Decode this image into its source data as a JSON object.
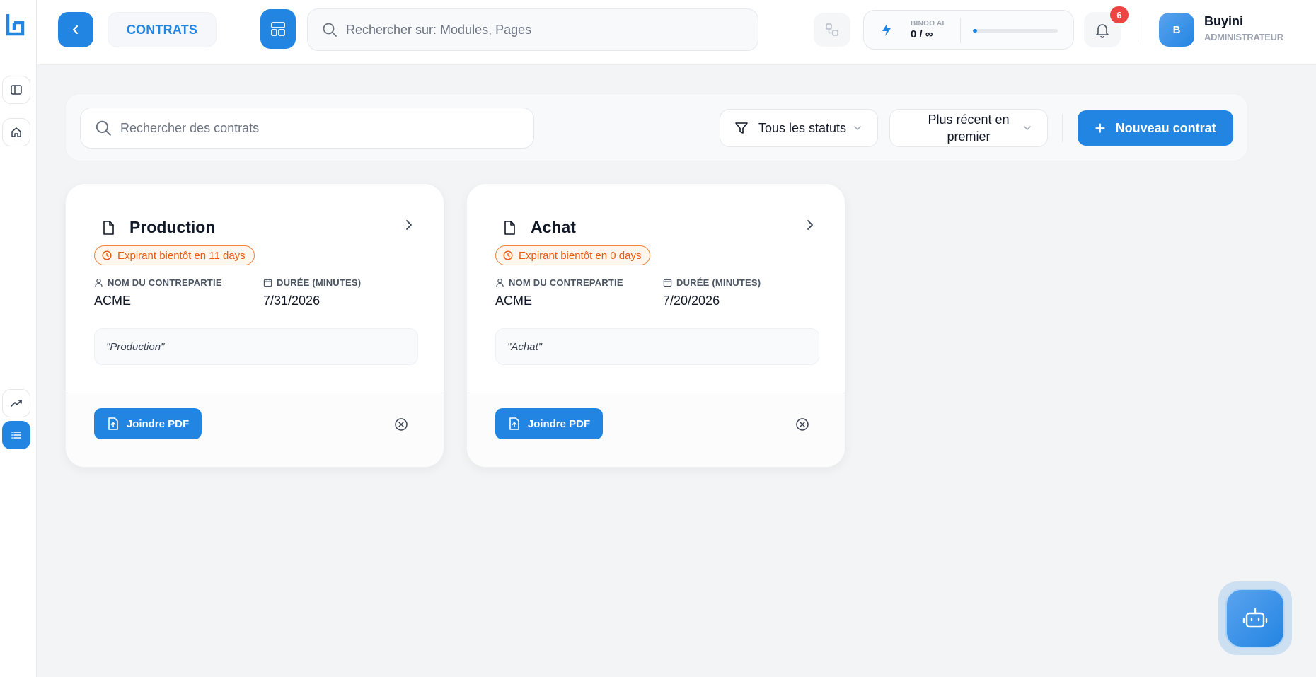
{
  "header": {
    "breadcrumb": "CONTRATS",
    "search_placeholder": "Rechercher sur: Modules, Pages",
    "ai": {
      "label": "BINOO AI",
      "count": "0 / ∞",
      "usage_fraction": 0.0
    },
    "notifications_count": "6",
    "user": {
      "initial": "B",
      "name": "Buyini",
      "role": "ADMINISTRATEUR"
    }
  },
  "toolbar": {
    "search_placeholder": "Rechercher des contrats",
    "status_filter": "Tous les statuts",
    "sort": "Plus récent en premier",
    "new_button": "Nouveau contrat"
  },
  "contracts": [
    {
      "title": "Production",
      "badge": "Expirant bientôt en 11 days",
      "counterparty_label": "NOM DU CONTREPARTIE",
      "counterparty": "ACME",
      "duration_label": "DURÉE (MINUTES)",
      "duration": "7/31/2026",
      "note": "\"Production\"",
      "pdf_button": "Joindre PDF"
    },
    {
      "title": "Achat",
      "badge": "Expirant bientôt en 0 days",
      "counterparty_label": "NOM DU CONTREPARTIE",
      "counterparty": "ACME",
      "duration_label": "DURÉE (MINUTES)",
      "duration": "7/20/2026",
      "note": "\"Achat\"",
      "pdf_button": "Joindre PDF"
    }
  ],
  "colors": {
    "accent": "#2385e2",
    "warning": "#ea580c",
    "badge_red": "#ef4444"
  },
  "icons": {
    "sidebar": [
      "sidebar-toggle-icon",
      "home-icon",
      "trending-up-icon",
      "list-icon"
    ],
    "card": [
      "document-icon",
      "chevron-right-icon",
      "clock-icon",
      "user-icon",
      "calendar-icon",
      "file-upload-icon",
      "close-circle-icon"
    ]
  }
}
